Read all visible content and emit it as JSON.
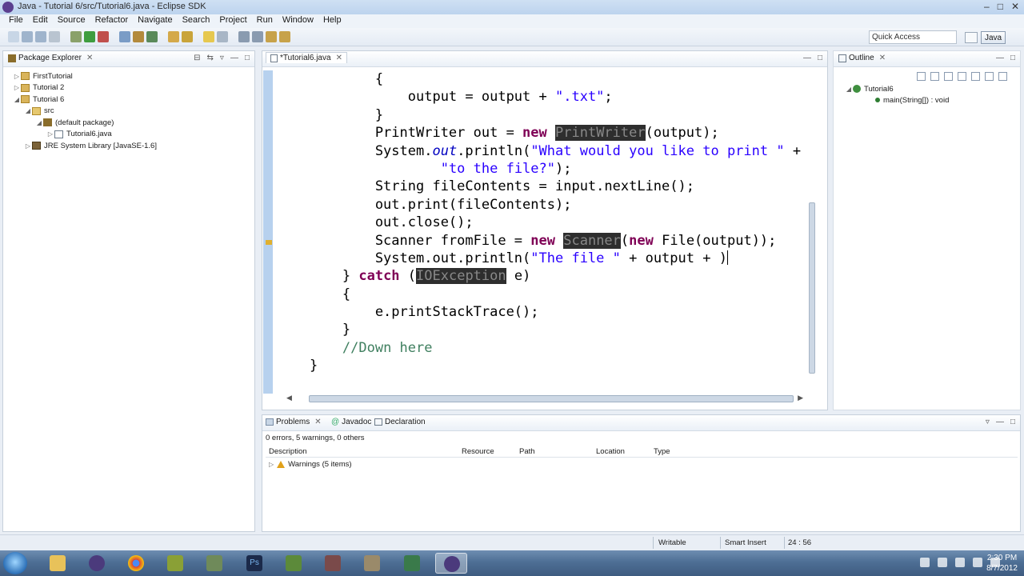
{
  "window": {
    "title": "Java - Tutorial 6/src/Tutorial6.java - Eclipse SDK"
  },
  "menu": [
    "File",
    "Edit",
    "Source",
    "Refactor",
    "Navigate",
    "Search",
    "Project",
    "Run",
    "Window",
    "Help"
  ],
  "toolbar": {
    "quick_access": "Quick Access",
    "perspective": "Java"
  },
  "package_explorer": {
    "title": "Package Explorer",
    "items": [
      {
        "label": "FirstTutorial",
        "level": 0,
        "expanded": false
      },
      {
        "label": "Tutorial 2",
        "level": 0,
        "expanded": false
      },
      {
        "label": "Tutorial 6",
        "level": 0,
        "expanded": true
      },
      {
        "label": "src",
        "level": 1,
        "expanded": true
      },
      {
        "label": "(default package)",
        "level": 2,
        "expanded": true
      },
      {
        "label": "Tutorial6.java",
        "level": 3,
        "expanded": false
      },
      {
        "label": "JRE System Library [JavaSE-1.6]",
        "level": 1,
        "expanded": false
      }
    ]
  },
  "editor": {
    "tab": "*Tutorial6.java",
    "lines": [
      "            {",
      "                output = output + \".txt\";",
      "            }",
      "            PrintWriter out = new PrintWriter(output);",
      "            System.out.println(\"What would you like to print \" +",
      "                    \"to the file?\");",
      "            String fileContents = input.nextLine();",
      "            out.print(fileContents);",
      "            out.close();",
      "            Scanner fromFile = new Scanner(new File(output));",
      "            System.out.println(\"The file \" + output + )",
      "        } catch (IOException e)",
      "        {",
      "            e.printStackTrace();",
      "        }",
      "        //Down here",
      "    }"
    ]
  },
  "outline": {
    "title": "Outline",
    "class_name": "Tutorial6",
    "method": "main(String[]) : void"
  },
  "problems": {
    "tabs": [
      "Problems",
      "Javadoc",
      "Declaration"
    ],
    "summary": "0 errors, 5 warnings, 0 others",
    "columns": [
      "Description",
      "Resource",
      "Path",
      "Location",
      "Type"
    ],
    "rows": [
      {
        "label": "Warnings (5 items)"
      }
    ]
  },
  "status": {
    "mode": "Writable",
    "insert": "Smart Insert",
    "position": "24 : 56"
  },
  "taskbar": {
    "time": "2:30 PM",
    "date": "8/7/2012"
  }
}
